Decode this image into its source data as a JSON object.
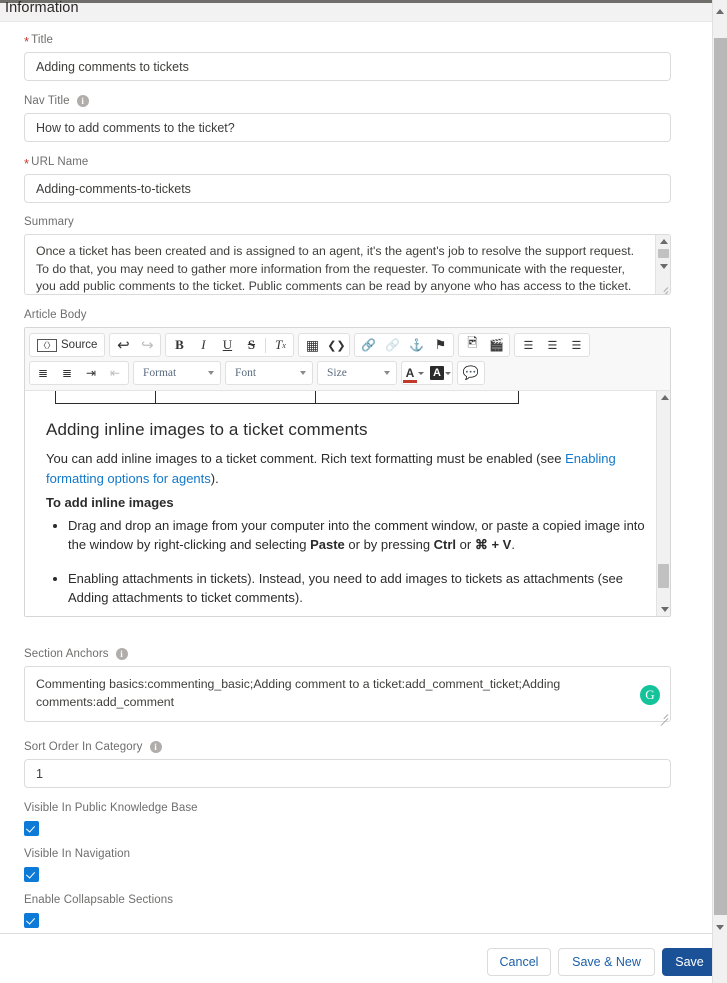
{
  "section": {
    "title": "Information"
  },
  "fields": {
    "title": {
      "label": "Title",
      "required": true,
      "value": "Adding comments to tickets"
    },
    "nav_title": {
      "label": "Nav Title",
      "required": false,
      "has_info": true,
      "value": "How to add comments to the ticket?"
    },
    "url_name": {
      "label": "URL Name",
      "required": true,
      "value": "Adding-comments-to-tickets"
    },
    "summary": {
      "label": "Summary",
      "value": "Once a ticket has been created and is assigned to an agent, it's the agent's job to resolve the support request. To do that, you may need to gather more information from the requester. To communicate with the requester, you add public comments to the ticket. Public comments can be read by anyone who has access to the ticket."
    },
    "article_body": {
      "label": "Article Body"
    },
    "section_anchors": {
      "label": "Section Anchors",
      "has_info": true,
      "value": "Commenting basics:commenting_basic;Adding comment to a ticket:add_comment_ticket;Adding comments:add_comment",
      "grammarly_glyph": "G"
    },
    "sort_order": {
      "label": "Sort Order In Category",
      "has_info": true,
      "value": "1"
    },
    "visible_public_kb": {
      "label": "Visible In Public Knowledge Base",
      "checked": true
    },
    "visible_navigation": {
      "label": "Visible In Navigation",
      "checked": true
    },
    "enable_collapsable": {
      "label": "Enable Collapsable Sections",
      "checked": true
    }
  },
  "editor": {
    "toolbar_row1": [
      {
        "name": "source-button",
        "label": "Source",
        "glyph": "▣",
        "type": "text"
      },
      {
        "name": "undo-button",
        "glyph": "↶",
        "type": "icon"
      },
      {
        "name": "redo-button",
        "glyph": "↷",
        "type": "icon",
        "disabled": true
      },
      {
        "name": "bold-button",
        "glyph": "B",
        "type": "icon"
      },
      {
        "name": "italic-button",
        "glyph": "I",
        "type": "icon"
      },
      {
        "name": "underline-button",
        "glyph": "U",
        "type": "icon"
      },
      {
        "name": "strikethrough-button",
        "glyph": "S",
        "type": "icon"
      },
      {
        "name": "remove-format-button",
        "glyph": "Tx",
        "type": "icon"
      },
      {
        "name": "table-button",
        "glyph": "▦",
        "type": "icon"
      },
      {
        "name": "source-code-button",
        "glyph": "‹›",
        "type": "icon"
      },
      {
        "name": "link-button",
        "glyph": "ὑ7",
        "type": "icon"
      },
      {
        "name": "unlink-button",
        "glyph": "⛓",
        "type": "icon",
        "disabled": true
      },
      {
        "name": "anchor-button",
        "glyph": "⚓",
        "type": "icon"
      },
      {
        "name": "flag-button",
        "glyph": "⚑",
        "type": "icon"
      },
      {
        "name": "image-button",
        "glyph": "ὛB",
        "type": "icon"
      },
      {
        "name": "video-button",
        "glyph": "ἹE",
        "type": "icon"
      },
      {
        "name": "align-left-button",
        "glyph": "≡",
        "type": "icon"
      },
      {
        "name": "align-center-button",
        "glyph": "≡",
        "type": "icon"
      },
      {
        "name": "align-right-button",
        "glyph": "≡",
        "type": "icon"
      }
    ],
    "toolbar_row2": [
      {
        "name": "bulleted-list-button",
        "glyph": "☰"
      },
      {
        "name": "numbered-list-button",
        "glyph": "☰"
      },
      {
        "name": "increase-indent-button",
        "glyph": "⇥"
      },
      {
        "name": "decrease-indent-button",
        "glyph": "⇤",
        "disabled": true
      }
    ],
    "selects": [
      {
        "name": "format-select",
        "label": "Format"
      },
      {
        "name": "font-select",
        "label": "Font"
      },
      {
        "name": "size-select",
        "label": "Size"
      }
    ],
    "color_buttons": [
      {
        "name": "text-color-button",
        "glyph": "A"
      },
      {
        "name": "background-color-button",
        "glyph": "A"
      },
      {
        "name": "comment-button",
        "glyph": "ὊC"
      }
    ],
    "content": {
      "heading": "Adding inline images to a ticket comments",
      "paragraph_pre": "You can add inline images to a ticket comment. Rich text formatting must be enabled (see ",
      "paragraph_link": "Enabling formatting options for agents",
      "paragraph_post": ").",
      "subheading": "To add inline images",
      "bullet1_a": "Drag and drop an image from your computer into the comment window, or paste a copied image into the window by right-clicking and selecting ",
      "bullet1_strong": "Paste",
      "bullet1_b": " or by pressing ",
      "bullet1_strong2": "Ctrl",
      "bullet1_c": " or ",
      "bullet1_strong3": "⌘ + V",
      "bullet1_d": ".",
      "bullet2": "Enabling attachments in tickets). Instead, you need to add images to tickets as attachments (see Adding attachments to ticket comments)."
    }
  },
  "footer": {
    "cancel_label": "Cancel",
    "save_new_label": "Save & New",
    "save_label": "Save"
  },
  "colors": {
    "brand_blue": "#1b5297",
    "link_blue": "#1278c8",
    "checkbox_blue": "#0d7ad8",
    "required_red": "#c23934",
    "grammarly_green": "#15c39a",
    "header_bg": "#f3f2f2"
  },
  "info_glyph": "i"
}
